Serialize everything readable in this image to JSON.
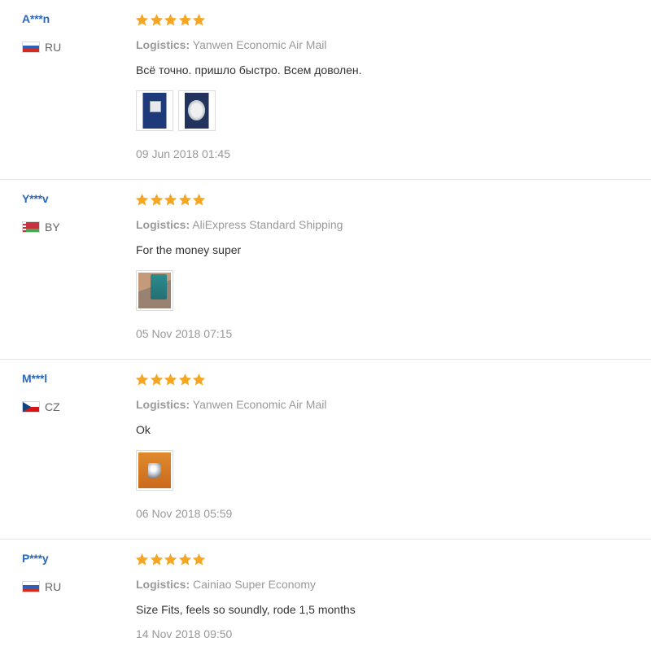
{
  "colors": {
    "username": "#2c68b8",
    "star": "#f5a623",
    "muted_text": "#999999",
    "body_text": "#333333",
    "divider": "#e6e6e6"
  },
  "reviews": [
    {
      "user": "A***n",
      "country_flag": "flag-ru-icon",
      "country": "RU",
      "rating": 5,
      "logistics_label": "Logistics:",
      "logistics_value": "Yanwen Economic Air Mail",
      "text": "Всё точно. пришло быстро. Всем доволен.",
      "photos": [
        "photo-package-blue",
        "photo-package-item"
      ],
      "date": "09 Jun 2018 01:45"
    },
    {
      "user": "Y***v",
      "country_flag": "flag-by-icon",
      "country": "BY",
      "rating": 5,
      "logistics_label": "Logistics:",
      "logistics_value": "AliExpress Standard Shipping",
      "text": "For the money super",
      "photos": [
        "photo-device"
      ],
      "date": "05 Nov 2018 07:15"
    },
    {
      "user": "M***l",
      "country_flag": "flag-cz-icon",
      "country": "CZ",
      "rating": 5,
      "logistics_label": "Logistics:",
      "logistics_value": "Yanwen Economic Air Mail",
      "text": "Ok",
      "photos": [
        "photo-item-orange"
      ],
      "date": "06 Nov 2018 05:59"
    },
    {
      "user": "P***y",
      "country_flag": "flag-ru-icon",
      "country": "RU",
      "rating": 5,
      "logistics_label": "Logistics:",
      "logistics_value": "Cainiao Super Economy",
      "text": "Size Fits, feels so soundly, rode 1,5 months",
      "photos": [],
      "date": "14 Nov 2018 09:50"
    }
  ]
}
